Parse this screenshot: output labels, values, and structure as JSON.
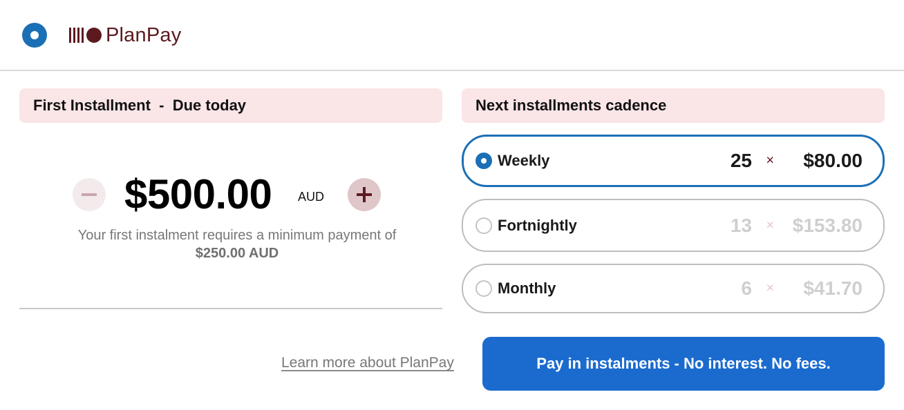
{
  "header": {
    "radio_icon": "radio-selected-icon",
    "brand": {
      "logo_icon": "planpay-logo-icon",
      "name": "PlanPay",
      "color": "#5c1a1f"
    }
  },
  "first_installment": {
    "heading": "First Installment  -  Due today",
    "amount": "$500.00",
    "currency": "AUD",
    "decrease_icon": "minus-icon",
    "increase_icon": "plus-icon",
    "note_prefix": "Your first instalment requires a minimum payment of ",
    "note_minimum": "$250.00 AUD"
  },
  "cadence": {
    "heading": "Next installments cadence",
    "options": [
      {
        "label": "Weekly",
        "count": "25",
        "times": "×",
        "price": "$80.00",
        "selected": true
      },
      {
        "label": "Fortnightly",
        "count": "13",
        "times": "×",
        "price": "$153.80",
        "selected": false
      },
      {
        "label": "Monthly",
        "count": "6",
        "times": "×",
        "price": "$41.70",
        "selected": false
      }
    ]
  },
  "footer": {
    "learn_more": "Learn more about PlanPay",
    "pay_button": "Pay in instalments - No interest. No fees."
  },
  "colors": {
    "accent_blue": "#1b6fb5",
    "button_blue": "#1b6bcf",
    "header_pink": "#fae5e7",
    "brand_maroon": "#5c1a1f"
  }
}
